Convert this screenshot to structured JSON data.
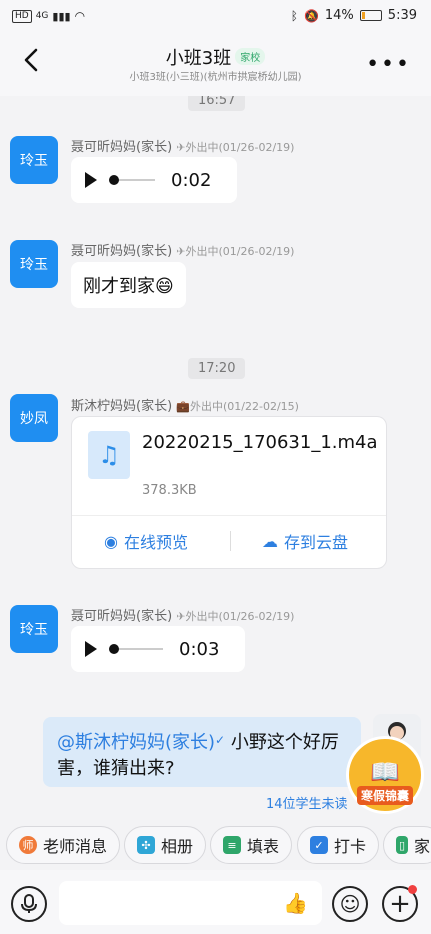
{
  "status_bar": {
    "network": "4G",
    "battery": "14%",
    "time": "5:39",
    "battery_level": 0.14
  },
  "header": {
    "title": "小班3班",
    "tag": "家校",
    "subtitle": "小班3班(小三班)(杭州市拱宸桥幼儿园)"
  },
  "chat": {
    "top_time": "16:57",
    "messages": [
      {
        "type": "voice",
        "avatar": "玲玉",
        "sender": "聂可昕妈妈(家长)",
        "status": "外出中(01/26-02/19)",
        "duration": "0:02"
      },
      {
        "type": "text",
        "avatar": "玲玉",
        "sender": "聂可昕妈妈(家长)",
        "status": "外出中(01/26-02/19)",
        "text": "刚才到家",
        "emoji": "😄"
      },
      {
        "type": "time",
        "time": "17:20"
      },
      {
        "type": "file",
        "avatar": "妙凤",
        "sender": "斯沐柠妈妈(家长)",
        "status": "外出中(01/22-02/15)",
        "file_name": "20220215_170631_1.m4a",
        "file_size": "378.3KB",
        "action_preview": "在线预览",
        "action_save": "存到云盘"
      },
      {
        "type": "voice",
        "avatar": "玲玉",
        "sender": "聂可昕妈妈(家长)",
        "status": "外出中(01/26-02/19)",
        "duration": "0:03"
      }
    ],
    "my_message": {
      "mention": "@斯沐柠妈妈(家长)",
      "text": " 小野这个好厉害，谁猜出来?",
      "unread": "14位学生未读"
    },
    "promo_label": "寒假锦囊"
  },
  "quick_actions": [
    {
      "label": "老师消息",
      "icon": "teacher-icon",
      "color": "#f07a3a"
    },
    {
      "label": "相册",
      "icon": "pinwheel-icon",
      "color": "#2fa6d6"
    },
    {
      "label": "填表",
      "icon": "form-icon",
      "color": "#2fa66a"
    },
    {
      "label": "打卡",
      "icon": "checkin-icon",
      "color": "#2d7fe0"
    },
    {
      "label": "家",
      "icon": "home-icon",
      "color": "#2fa66a"
    }
  ],
  "input": {
    "placeholder": ""
  }
}
